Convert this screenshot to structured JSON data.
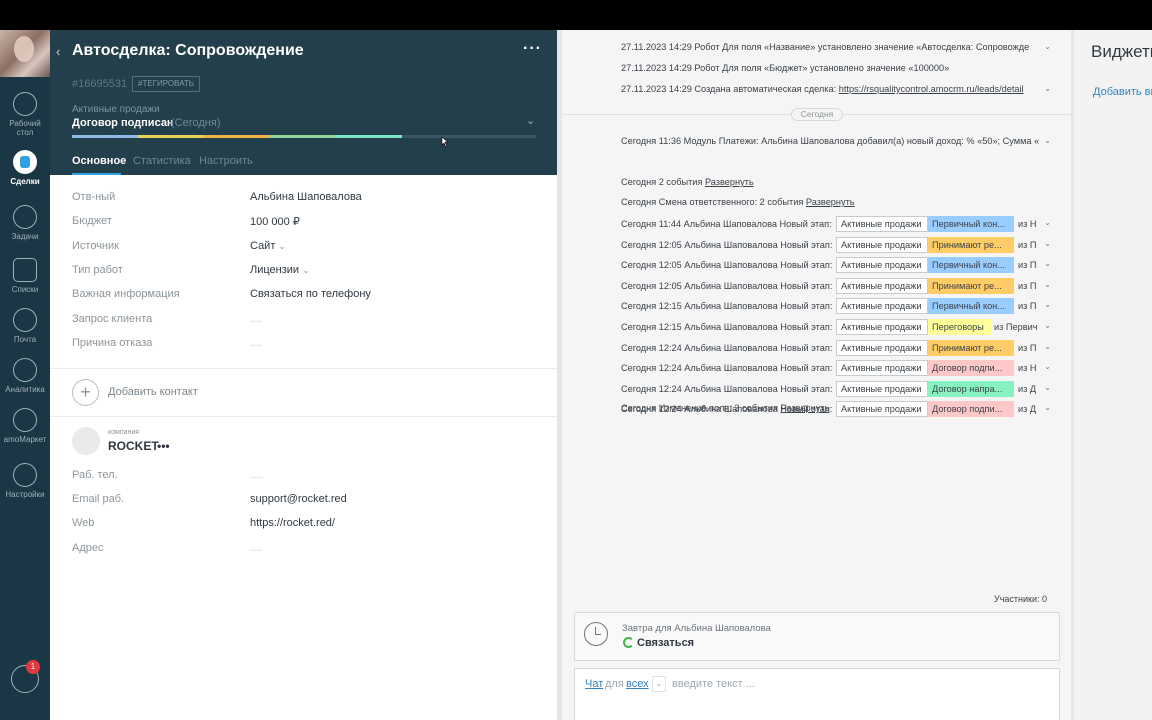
{
  "nav": {
    "items": [
      {
        "label": "Рабочий стол",
        "icon": "dashboard-icon"
      },
      {
        "label": "Сделки",
        "icon": "deals-icon"
      },
      {
        "label": "Задачи",
        "icon": "tasks-icon"
      },
      {
        "label": "Списки",
        "icon": "lists-icon"
      },
      {
        "label": "Почта",
        "icon": "mail-icon"
      },
      {
        "label": "Аналитика",
        "icon": "analytics-icon"
      },
      {
        "label": "amoМаркет",
        "icon": "market-icon"
      },
      {
        "label": "Настройки",
        "icon": "settings-icon"
      }
    ],
    "chat_badge": "1"
  },
  "deal": {
    "title": "Автосделка: Сопровождение",
    "id": "#16695531",
    "tag_button": "#ТЕГИРОВАТЬ",
    "pipeline": "Активные продажи",
    "stage": "Договор подписан",
    "stage_date": "(Сегодня)",
    "tabs": [
      "Основное",
      "Статистика",
      "Настроить"
    ]
  },
  "fields": [
    {
      "label": "Отв-ный",
      "value": "Альбина Шаповалова"
    },
    {
      "label": "Бюджет",
      "value": "100 000  ₽"
    },
    {
      "label": "Источник",
      "value": "Сайт"
    },
    {
      "label": "Тип работ",
      "value": "Лицензии"
    },
    {
      "label": "Важная информация",
      "value": "Связаться по телефону"
    },
    {
      "label": "Запрос клиента",
      "value": "...."
    },
    {
      "label": "Причина отказа",
      "value": "...."
    }
  ],
  "add_contact": "Добавить контакт",
  "company": {
    "kicker": "компания",
    "name": "ROCKET",
    "more": "•••",
    "fields": [
      {
        "label": "Раб. тел.",
        "value": "...."
      },
      {
        "label": "Email раб.",
        "value": "support@rocket.red"
      },
      {
        "label": "Web",
        "value": "https://rocket.red/"
      },
      {
        "label": "Адрес",
        "value": "...."
      }
    ]
  },
  "feed": {
    "top_lines": [
      {
        "text": "27.11.2023 14:29 Робот Для поля «Название» установлено значение «Автосделка: Сопровожде"
      },
      {
        "text": "27.11.2023 14:29 Робот Для поля «Бюджет» установлено значение «100000»"
      },
      {
        "text": "27.11.2023 14:29 Создана автоматическая сделка: ",
        "link": "https://rsqualitycontrol.amocrm.ru/leads/detail"
      }
    ],
    "today_label": "Сегодня",
    "payment_line": "Сегодня 11:36 Модуль Платежи: Альбина Шаповалова добавил(а) новый доход: % «50»; Сумма «",
    "events_line": {
      "text": "Сегодня 2 события ",
      "link": "Развернуть"
    },
    "owner_line": {
      "text": "Сегодня Смена ответственного: 2 события ",
      "link": "Развернуть"
    },
    "field_change_line": {
      "text": "Сегодня Изменение поля: 3 события ",
      "link": "Развернуть"
    },
    "stage_rows": [
      {
        "text": "Сегодня 11:44 Альбина Шаповалова Новый этап:",
        "from": "Активные продажи",
        "to": "Первичный кон...",
        "tail": "из Н",
        "color": "#99ccff"
      },
      {
        "text": "Сегодня 12:05 Альбина Шаповалова Новый этап:",
        "from": "Активные продажи",
        "to": "Принимают ре...",
        "tail": "из П",
        "color": "#ffcc66"
      },
      {
        "text": "Сегодня 12:05 Альбина Шаповалова Новый этап:",
        "from": "Активные продажи",
        "to": "Первичный кон...",
        "tail": "из П",
        "color": "#99ccff"
      },
      {
        "text": "Сегодня 12:05 Альбина Шаповалова Новый этап:",
        "from": "Активные продажи",
        "to": "Принимают ре...",
        "tail": "из П",
        "color": "#ffcc66"
      },
      {
        "text": "Сегодня 12:15 Альбина Шаповалова Новый этап:",
        "from": "Активные продажи",
        "to": "Первичный кон...",
        "tail": "из П",
        "color": "#99ccff"
      },
      {
        "text": "Сегодня 12:15 Альбина Шаповалова Новый этап:",
        "from": "Активные продажи",
        "to": "Переговоры",
        "tail": "из Первич",
        "color": "#ffff99"
      },
      {
        "text": "Сегодня 12:24 Альбина Шаповалова Новый этап:",
        "from": "Активные продажи",
        "to": "Принимают ре...",
        "tail": "из П",
        "color": "#ffcc66"
      },
      {
        "text": "Сегодня 12:24 Альбина Шаповалова Новый этап:",
        "from": "Активные продажи",
        "to": "Договор подпи...",
        "tail": "из Н",
        "color": "#ffc8c8"
      },
      {
        "text": "Сегодня 12:24 Альбина Шаповалова Новый этап:",
        "from": "Активные продажи",
        "to": "Договор напра...",
        "tail": "из Д",
        "color": "#87f2c0"
      },
      {
        "text": "Сегодня 12:24 Альбина Шаповалова Новый этап:",
        "from": "Активные продажи",
        "to": "Договор подпи...",
        "tail": "из Д",
        "color": "#ffc8c8"
      }
    ],
    "participants": "Участники: 0",
    "task": {
      "when": "Завтра для Альбина Шаповалова",
      "action": "Связаться"
    },
    "composer": {
      "chat": "Чат",
      "for": "для",
      "all": "всех",
      "placeholder": "введите текст ..."
    }
  },
  "widgets": {
    "title": "Виджеты",
    "add": "Добавить виджет"
  },
  "colors": {
    "nav_bg": "#1b3644",
    "header_bg": "#243f4c",
    "accent": "#2fa0e0"
  },
  "progress_fill": 0.71
}
